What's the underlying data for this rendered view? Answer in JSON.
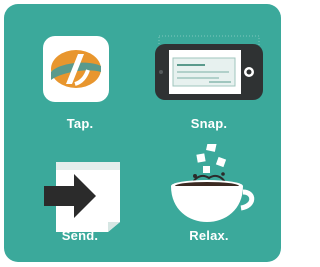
{
  "steps": {
    "tap": {
      "label": "Tap.",
      "icon": "app-logo-icon"
    },
    "snap": {
      "label": "Snap.",
      "icon": "phone-camera-check-icon"
    },
    "send": {
      "label": "Send.",
      "icon": "send-arrow-document-icon"
    },
    "relax": {
      "label": "Relax.",
      "icon": "coffee-cup-icon"
    }
  },
  "colors": {
    "background": "#3ba99b",
    "text": "#ffffff",
    "logo_orange": "#e8962e",
    "logo_teal": "#5a9a8c",
    "phone_dark": "#2f3233"
  }
}
